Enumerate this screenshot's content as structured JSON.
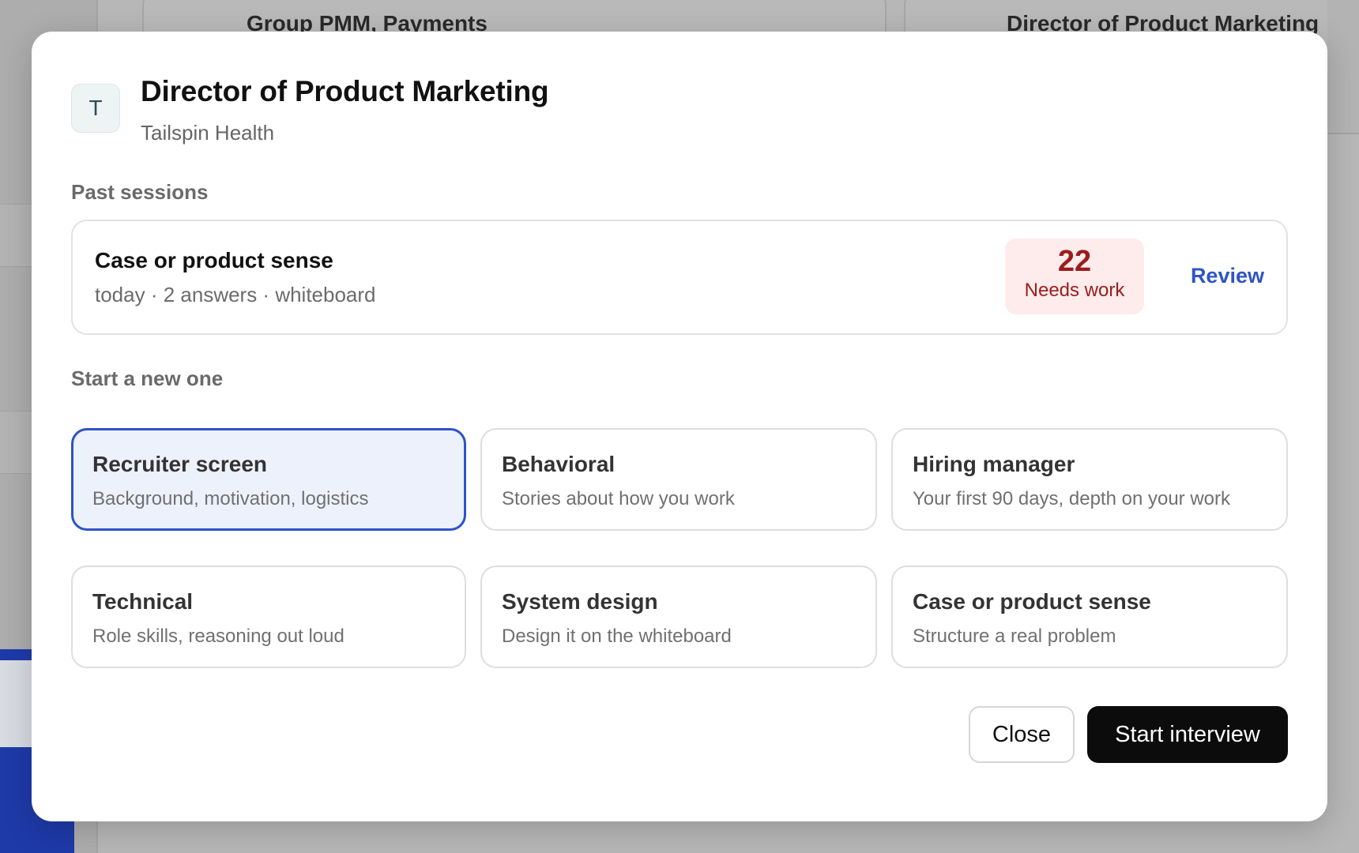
{
  "background": {
    "cards": [
      {
        "title": "Group PMM, Payments"
      },
      {
        "title": "Director of Product Marketing"
      }
    ]
  },
  "modal": {
    "avatar_letter": "T",
    "title": "Director of Product Marketing",
    "company": "Tailspin Health",
    "past_sessions_label": "Past sessions",
    "past_sessions": [
      {
        "name": "Case or product sense",
        "meta": "today · 2 answers · whiteboard",
        "score": "22",
        "score_label": "Needs work",
        "review_label": "Review"
      }
    ],
    "start_new_label": "Start a new one",
    "interview_types": [
      {
        "title": "Recruiter screen",
        "description": "Background, motivation, logistics",
        "selected": true
      },
      {
        "title": "Behavioral",
        "description": "Stories about how you work",
        "selected": false
      },
      {
        "title": "Hiring manager",
        "description": "Your first 90 days, depth on your work",
        "selected": false
      },
      {
        "title": "Technical",
        "description": "Role skills, reasoning out loud",
        "selected": false
      },
      {
        "title": "System design",
        "description": "Design it on the whiteboard",
        "selected": false
      },
      {
        "title": "Case or product sense",
        "description": "Structure a real problem",
        "selected": false
      }
    ],
    "close_label": "Close",
    "start_label": "Start interview"
  },
  "colors": {
    "accent": "#2f52c7",
    "selected_bg": "#edf1fc",
    "score_bg": "#fdeceb",
    "score_text": "#9c1c1c",
    "primary_button": "#0c0c0c"
  }
}
